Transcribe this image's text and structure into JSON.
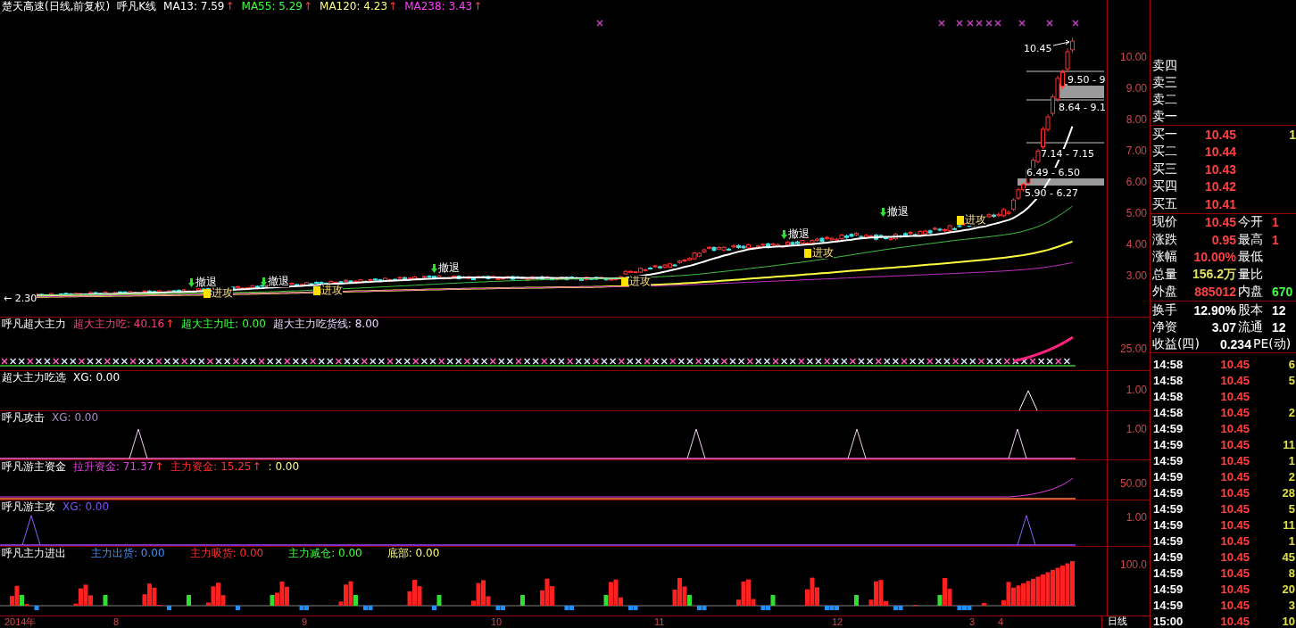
{
  "header": {
    "title": "楚天高速(日线,前复权)",
    "indicator": "呼凡K线",
    "ma": [
      {
        "label": "MA13: 7.59",
        "arrow": "↑",
        "color": "#ffffff"
      },
      {
        "label": "MA55: 5.29",
        "arrow": "↑",
        "color": "#40ff40"
      },
      {
        "label": "MA120: 4.23",
        "arrow": "↑",
        "color": "#ffff80"
      },
      {
        "label": "MA238: 3.43",
        "arrow": "↑",
        "color": "#ff40ff"
      }
    ]
  },
  "price_axis": [
    "10.00",
    "9.00",
    "8.00",
    "7.00",
    "6.00",
    "5.00",
    "4.00",
    "3.00"
  ],
  "signals": [
    {
      "kind": "retreat",
      "text": "撤退"
    },
    {
      "kind": "attack",
      "text": "进攻"
    },
    {
      "kind": "retreat",
      "text": "撤退"
    },
    {
      "kind": "attack",
      "text": "进攻"
    },
    {
      "kind": "retreat",
      "text": "撤退"
    },
    {
      "kind": "attack",
      "text": "进攻"
    },
    {
      "kind": "retreat",
      "text": "撤退"
    },
    {
      "kind": "attack",
      "text": "进攻"
    },
    {
      "kind": "retreat",
      "text": "撤退"
    },
    {
      "kind": "attack",
      "text": "进攻"
    }
  ],
  "price_marks": {
    "high": "10.45",
    "low": "← 2.30"
  },
  "chip_labels": [
    "9.50 - 9",
    "8.64 - 9.1",
    "7.14 - 7.15",
    "6.49 - 6.50",
    "5.90 - 6.27"
  ],
  "panels": [
    {
      "title": "呼凡超大主力",
      "items": [
        {
          "text": "超大主力吃: 40.16",
          "arrow": "↑",
          "color": "#ff3f7f"
        },
        {
          "text": "超大主力吐: 0.00",
          "color": "#40ff40"
        },
        {
          "text": "超大主力吃货线: 8.00",
          "color": "#e8d8ff"
        }
      ],
      "axis": "25.00"
    },
    {
      "title": "超大主力吃选",
      "items": [
        {
          "text": "XG: 0.00",
          "color": "#ffffff"
        }
      ],
      "axis": "1.00"
    },
    {
      "title": "呼凡攻击",
      "items": [
        {
          "text": "XG: 0.00",
          "color": "#a890c0"
        }
      ],
      "axis": "1.00"
    },
    {
      "title": "呼凡游主资金",
      "items": [
        {
          "text": "拉升资金: 71.37",
          "arrow": "↑",
          "color": "#e040e0"
        },
        {
          "text": "主力资金: 15.25",
          "arrow": "↑",
          "color": "#ff3030"
        },
        {
          "text": ": 0.00",
          "color": "#ffff80"
        }
      ],
      "axis": "50.00"
    },
    {
      "title": "呼凡游主攻",
      "items": [
        {
          "text": "XG: 0.00",
          "color": "#8050ff"
        }
      ],
      "axis": "1.00"
    },
    {
      "title": "呼凡主力进出",
      "items": [
        {
          "text": "主力出货: 0.00",
          "color": "#4090ff"
        },
        {
          "text": "主力吸货: 0.00",
          "color": "#ff3030"
        },
        {
          "text": "主力减仓: 0.00",
          "color": "#40ff40"
        },
        {
          "text": "底部: 0.00",
          "color": "#ffff80"
        }
      ],
      "axis": "100.0"
    }
  ],
  "time_axis": {
    "labels": [
      "2014年",
      "8",
      "9",
      "10",
      "11",
      "12",
      "3",
      "4"
    ],
    "period": "日线"
  },
  "quote": {
    "asks": [
      {
        "label": "卖四"
      },
      {
        "label": "卖三"
      },
      {
        "label": "卖二"
      },
      {
        "label": "卖一"
      }
    ],
    "bids": [
      {
        "label": "买一",
        "price": "10.45",
        "volume": "1"
      },
      {
        "label": "买二",
        "price": "10.44"
      },
      {
        "label": "买三",
        "price": "10.43"
      },
      {
        "label": "买四",
        "price": "10.42"
      },
      {
        "label": "买五",
        "price": "10.41"
      }
    ],
    "stats": [
      {
        "cells": [
          {
            "label": "现价",
            "value": "10.45",
            "color": "#ff4040"
          },
          {
            "label": "今开",
            "value": "1",
            "color": "#ff4040"
          }
        ]
      },
      {
        "cells": [
          {
            "label": "涨跌",
            "value": "0.95",
            "color": "#ff4040"
          },
          {
            "label": "最高",
            "value": "1",
            "color": "#ff4040"
          }
        ]
      },
      {
        "cells": [
          {
            "label": "涨幅",
            "value": "10.00%",
            "color": "#ff4040"
          },
          {
            "label": "最低"
          }
        ]
      },
      {
        "cells": [
          {
            "label": "总量",
            "value": "156.2万",
            "color": "#e0e060"
          },
          {
            "label": "量比"
          }
        ]
      },
      {
        "cells": [
          {
            "label": "外盘",
            "value": "885012",
            "color": "#ff4040"
          },
          {
            "label": "内盘",
            "value": "670",
            "color": "#40ff40"
          }
        ]
      }
    ],
    "finance": [
      {
        "cells": [
          {
            "label": "换手",
            "value": "12.90%"
          },
          {
            "label": "股本",
            "value": "12"
          }
        ]
      },
      {
        "cells": [
          {
            "label": "净资",
            "value": "3.07"
          },
          {
            "label": "流通",
            "value": "12"
          }
        ]
      },
      {
        "cells": [
          {
            "label": "收益(四)",
            "value": "0.234"
          },
          {
            "label": "PE(动)"
          }
        ]
      }
    ],
    "ticks": [
      {
        "time": "14:58",
        "price": "10.45",
        "volume": "6"
      },
      {
        "time": "14:58",
        "price": "10.45",
        "volume": "5"
      },
      {
        "time": "14:58",
        "price": "10.45"
      },
      {
        "time": "14:58",
        "price": "10.45",
        "volume": "2"
      },
      {
        "time": "14:59",
        "price": "10.45"
      },
      {
        "time": "14:59",
        "price": "10.45",
        "volume": "11"
      },
      {
        "time": "14:59",
        "price": "10.45",
        "volume": "1"
      },
      {
        "time": "14:59",
        "price": "10.45",
        "volume": "2"
      },
      {
        "time": "14:59",
        "price": "10.45",
        "volume": "28"
      },
      {
        "time": "14:59",
        "price": "10.45",
        "volume": "5"
      },
      {
        "time": "14:59",
        "price": "10.45",
        "volume": "11"
      },
      {
        "time": "14:59",
        "price": "10.45",
        "volume": "1"
      },
      {
        "time": "14:59",
        "price": "10.45",
        "volume": "45"
      },
      {
        "time": "14:59",
        "price": "10.45",
        "volume": "8"
      },
      {
        "time": "14:59",
        "price": "10.45",
        "volume": "20"
      },
      {
        "time": "14:59",
        "price": "10.45",
        "volume": "3"
      },
      {
        "time": "15:00",
        "price": "10.45",
        "volume": "10"
      }
    ]
  }
}
